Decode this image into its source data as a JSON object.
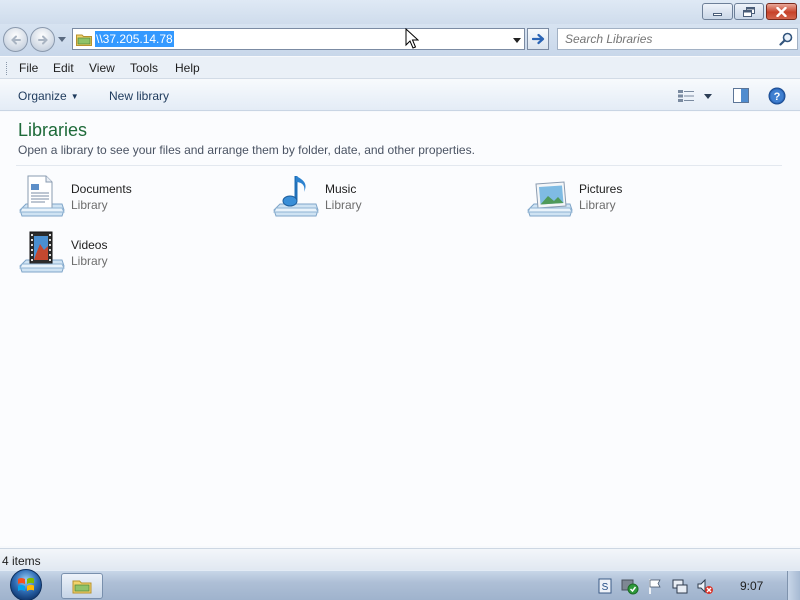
{
  "address": {
    "path": "\\\\37.205.14.78"
  },
  "search": {
    "placeholder": "Search Libraries"
  },
  "menu": {
    "file": "File",
    "edit": "Edit",
    "view": "View",
    "tools": "Tools",
    "help": "Help"
  },
  "toolbar": {
    "organize": "Organize",
    "new_library": "New library"
  },
  "content": {
    "title": "Libraries",
    "subtitle": "Open a library to see your files and arrange them by folder, date, and other properties.",
    "libraries": [
      {
        "name": "Documents",
        "type": "Library",
        "icon": "documents-library-icon"
      },
      {
        "name": "Music",
        "type": "Library",
        "icon": "music-library-icon"
      },
      {
        "name": "Pictures",
        "type": "Library",
        "icon": "pictures-library-icon"
      },
      {
        "name": "Videos",
        "type": "Library",
        "icon": "videos-library-icon"
      }
    ]
  },
  "status": {
    "items": "4 items"
  },
  "taskbar": {
    "clock": "9:07"
  },
  "colors": {
    "title_green": "#1e6a39",
    "selection_blue": "#3399ff",
    "close_red": "#c7422a"
  }
}
